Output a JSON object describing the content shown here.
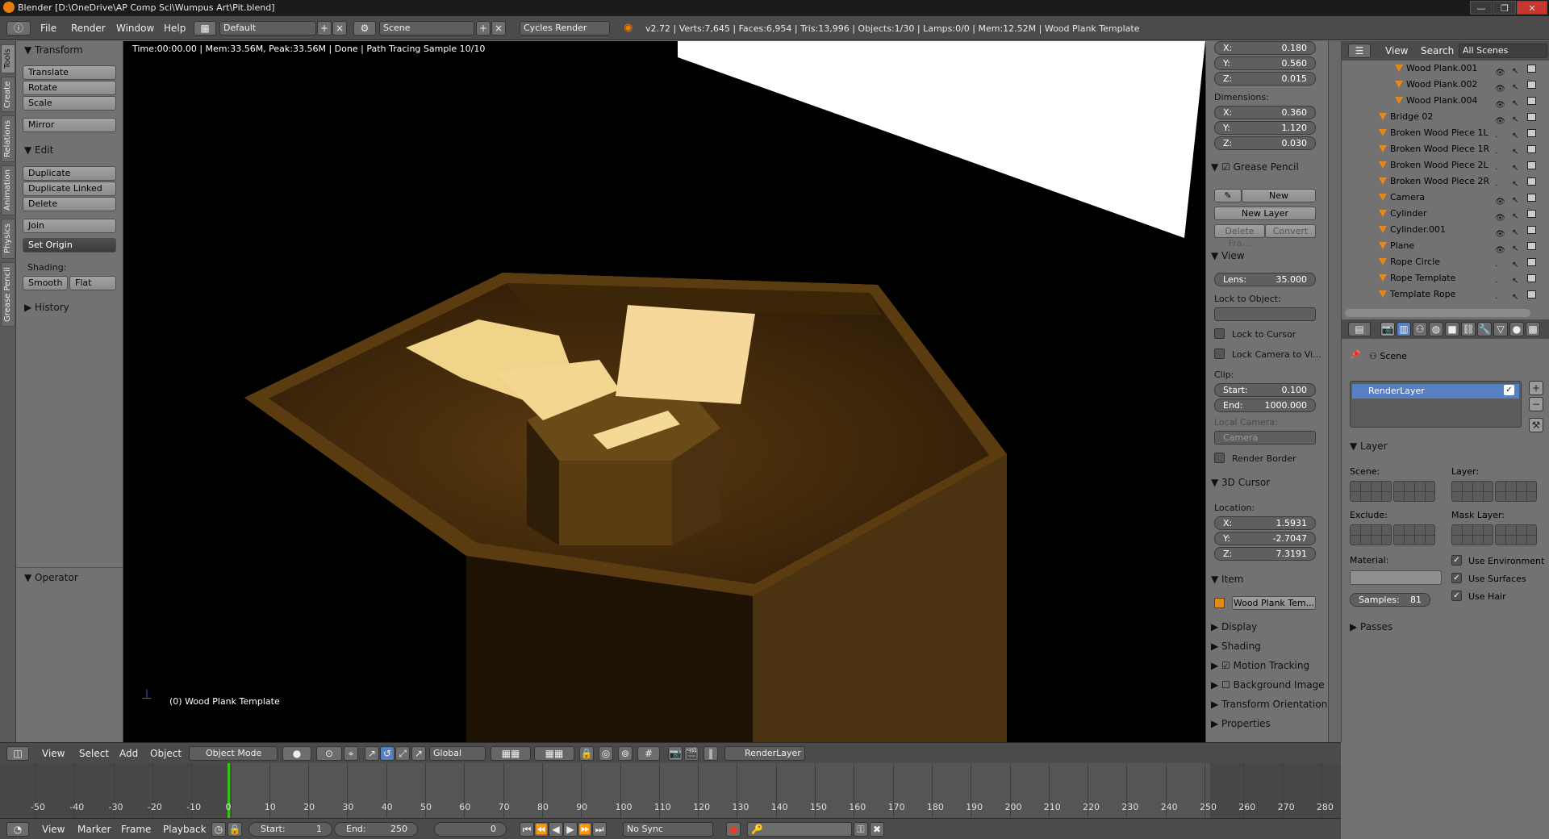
{
  "window": {
    "title": "Blender [D:\\OneDrive\\AP Comp Sci\\Wumpus Art\\Pit.blend]",
    "buttons": [
      "—",
      "❐",
      "✕"
    ]
  },
  "info_header": {
    "menus": [
      "File",
      "Render",
      "Window",
      "Help"
    ],
    "screen_layout": "Default",
    "scene": "Scene",
    "render_engine": "Cycles Render",
    "stats": "v2.72 | Verts:7,645 | Faces:6,954 | Tris:13,996 | Objects:1/30 | Lamps:0/0 | Mem:12.52M | Wood Plank Template"
  },
  "tool_tabs": [
    "Tools",
    "Create",
    "Relations",
    "Animation",
    "Physics",
    "Grease Pencil"
  ],
  "tool_shelf": {
    "transform_header": "Transform",
    "transform_buttons": [
      "Translate",
      "Rotate",
      "Scale"
    ],
    "mirror": "Mirror",
    "edit_header": "Edit",
    "edit_buttons": [
      "Duplicate",
      "Duplicate Linked",
      "Delete"
    ],
    "join": "Join",
    "set_origin": "Set Origin",
    "shading_label": "Shading:",
    "smooth": "Smooth",
    "flat": "Flat",
    "history_header": "History",
    "operator_header": "Operator"
  },
  "viewport": {
    "render_info": "Time:00:00.00 | Mem:33.56M, Peak:33.56M | Done | Path Tracing Sample 10/10",
    "object_label": "(0) Wood Plank Template"
  },
  "n_panel": {
    "location": [
      {
        "axis": "X:",
        "value": "0.180"
      },
      {
        "axis": "Y:",
        "value": "0.560"
      },
      {
        "axis": "Z:",
        "value": "0.015"
      }
    ],
    "dimensions_label": "Dimensions:",
    "dimensions": [
      {
        "axis": "X:",
        "value": "0.360"
      },
      {
        "axis": "Y:",
        "value": "1.120"
      },
      {
        "axis": "Z:",
        "value": "0.030"
      }
    ],
    "grease_pencil_header": "Grease Pencil",
    "gp_new": "New",
    "gp_new_layer": "New Layer",
    "gp_delete_frame": "Delete Fra...",
    "gp_convert": "Convert",
    "view_header": "View",
    "lens_label": "Lens:",
    "lens_value": "35.000",
    "lock_to_object": "Lock to Object:",
    "lock_to_cursor": "Lock to Cursor",
    "lock_camera": "Lock Camera to Vi...",
    "clip_label": "Clip:",
    "clip_start_label": "Start:",
    "clip_start": "0.100",
    "clip_end_label": "End:",
    "clip_end": "1000.000",
    "local_camera": "Local Camera:",
    "camera_field": "Camera",
    "render_border": "Render Border",
    "cursor_header": "3D Cursor",
    "cursor_location_label": "Location:",
    "cursor": [
      {
        "axis": "X:",
        "value": "1.5931"
      },
      {
        "axis": "Y:",
        "value": "-2.7047"
      },
      {
        "axis": "Z:",
        "value": "7.3191"
      }
    ],
    "item_header": "Item",
    "item_name": "Wood Plank Tem...",
    "collapsed": [
      "Display",
      "Shading",
      "Motion Tracking",
      "Background Image",
      "Transform Orientation",
      "Properties"
    ]
  },
  "outliner": {
    "view": "View",
    "search": "Search",
    "filter": "All Scenes",
    "rows": [
      {
        "name": "Wood Plank.001"
      },
      {
        "name": "Wood Plank.002"
      },
      {
        "name": "Wood Plank.004"
      },
      {
        "name": "Bridge 02"
      },
      {
        "name": "Broken Wood Piece 1L"
      },
      {
        "name": "Broken Wood Piece 1R"
      },
      {
        "name": "Broken Wood Piece 2L"
      },
      {
        "name": "Broken Wood Piece 2R"
      },
      {
        "name": "Camera"
      },
      {
        "name": "Cylinder"
      },
      {
        "name": "Cylinder.001"
      },
      {
        "name": "Plane"
      },
      {
        "name": "Rope Circle"
      },
      {
        "name": "Rope Template"
      },
      {
        "name": "Template Rope"
      }
    ]
  },
  "properties": {
    "scene_label": "Scene",
    "render_layer": "RenderLayer",
    "layer_header": "Layer",
    "scene_col": "Scene:",
    "layer_col": "Layer:",
    "exclude": "Exclude:",
    "mask_layer": "Mask Layer:",
    "material": "Material:",
    "use_environment": "Use Environment",
    "use_surfaces": "Use Surfaces",
    "use_hair": "Use Hair",
    "samples_label": "Samples:",
    "samples_value": "81",
    "passes_header": "Passes"
  },
  "view3d_header": {
    "menus": [
      "View",
      "Select",
      "Add",
      "Object"
    ],
    "mode": "Object Mode",
    "orientation": "Global",
    "render_layer": "RenderLayer"
  },
  "timeline": {
    "ticks": [
      "-50",
      "-40",
      "-30",
      "-20",
      "-10",
      "0",
      "10",
      "20",
      "30",
      "40",
      "50",
      "60",
      "70",
      "80",
      "90",
      "100",
      "110",
      "120",
      "130",
      "140",
      "150",
      "160",
      "170",
      "180",
      "190",
      "200",
      "210",
      "220",
      "230",
      "240",
      "250",
      "260",
      "270",
      "280"
    ],
    "menus": [
      "View",
      "Marker",
      "Frame",
      "Playback"
    ],
    "start_label": "Start:",
    "start": "1",
    "end_label": "End:",
    "end": "250",
    "current": "0",
    "sync": "No Sync"
  },
  "colors": {
    "accent_orange": "#e08a1a",
    "selected_blue": "#5680c2",
    "frame_green": "#38c018"
  }
}
